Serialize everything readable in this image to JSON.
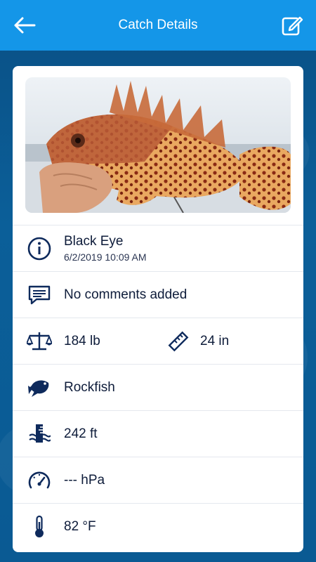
{
  "header": {
    "title": "Catch Details",
    "back_icon": "arrow-left-icon",
    "edit_icon": "edit-icon"
  },
  "colors": {
    "topbar": "#1496e8",
    "icon": "#0e2a5c",
    "text": "#0e1c3a"
  },
  "catch": {
    "name": "Black Eye",
    "datetime": "6/2/2019 10:09 AM",
    "comments": "No comments added",
    "weight": "184 lb",
    "length": "24 in",
    "species": "Rockfish",
    "depth": "242 ft",
    "pressure": "--- hPa",
    "temperature": "82 °F"
  }
}
